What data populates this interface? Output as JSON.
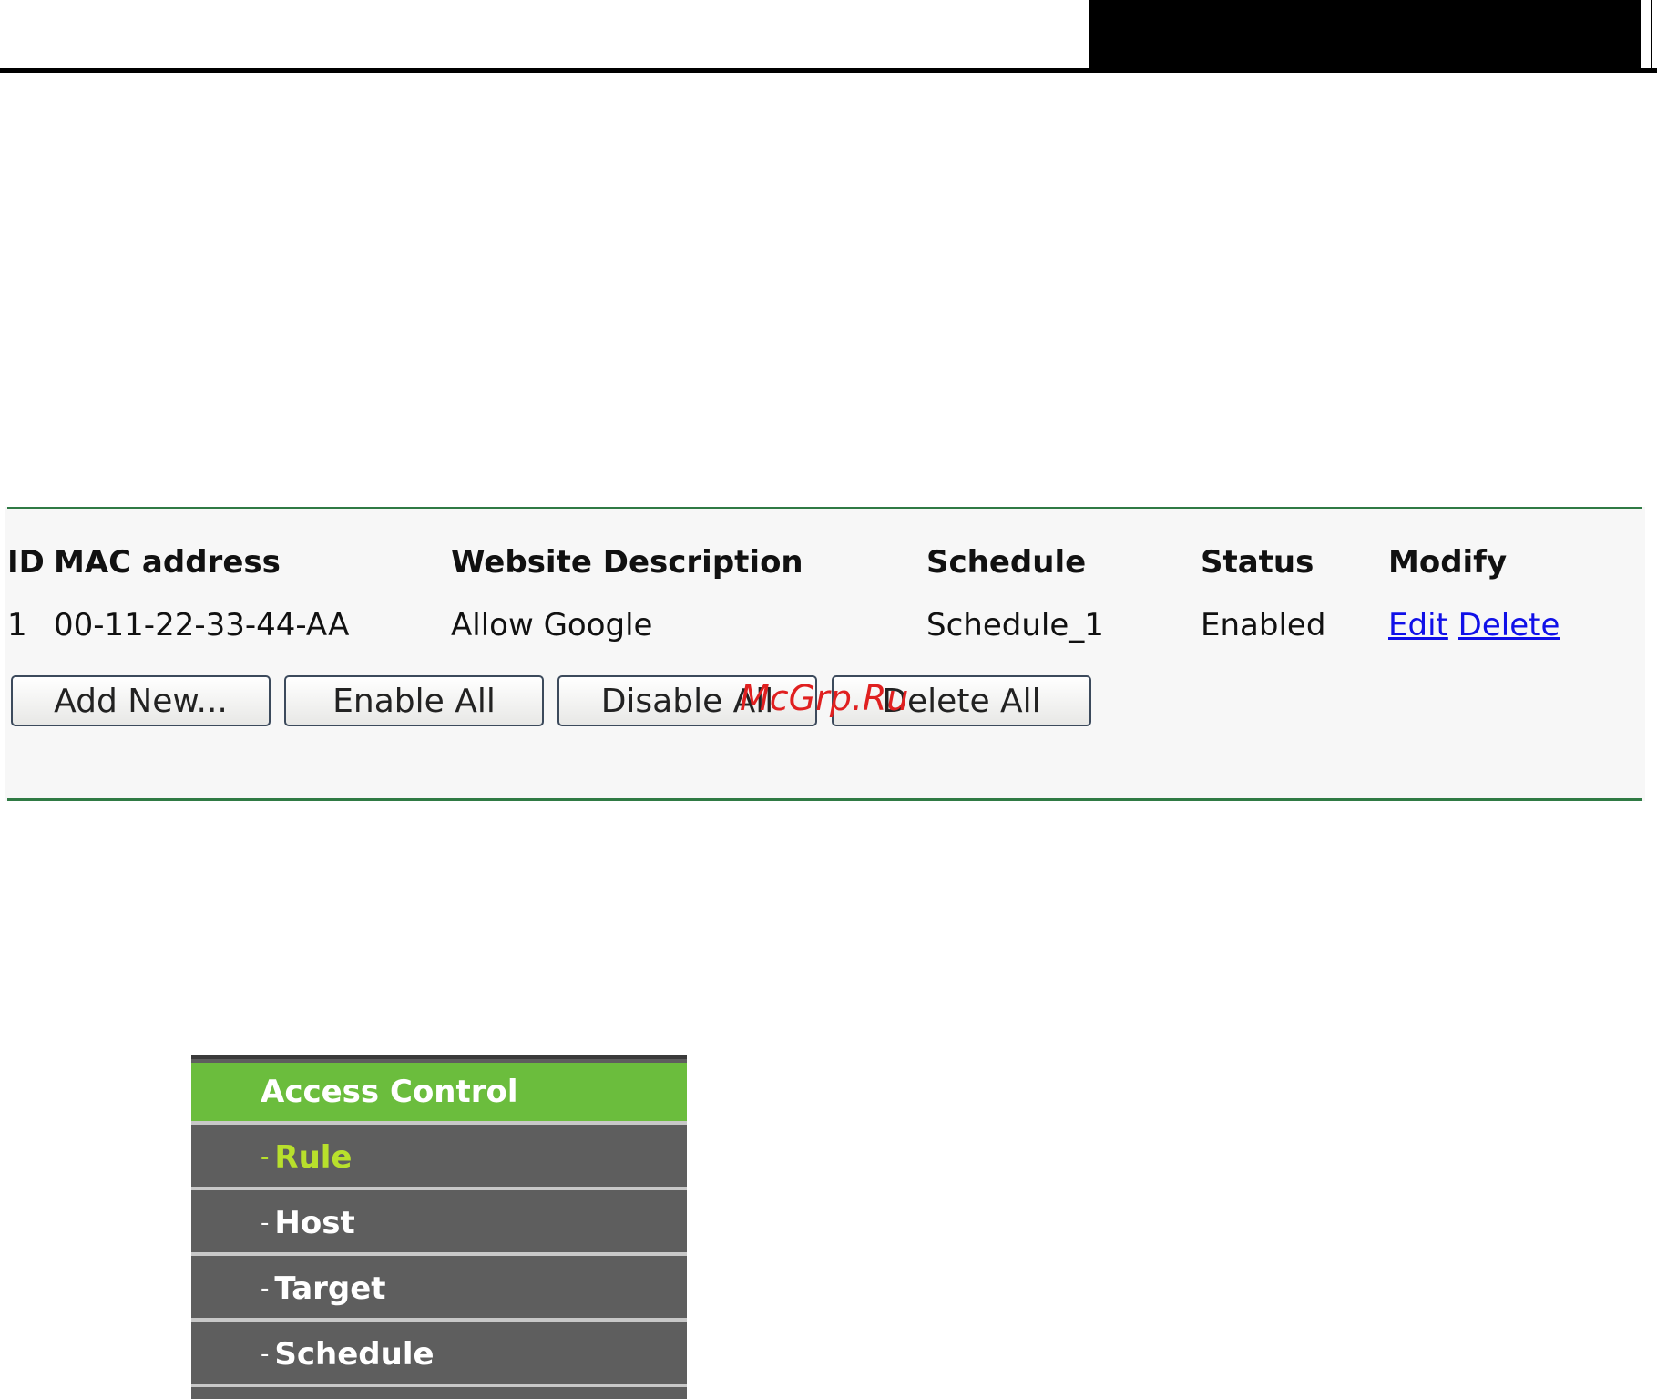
{
  "table": {
    "headers": [
      "ID",
      "MAC address",
      "Website Description",
      "Schedule",
      "Status",
      "Modify"
    ],
    "rows": [
      {
        "id": "1",
        "mac": "00-11-22-33-44-AA",
        "description": "Allow Google",
        "schedule": "Schedule_1",
        "status": "Enabled",
        "edit": "Edit",
        "delete": "Delete"
      }
    ]
  },
  "buttons": {
    "add_new": "Add New...",
    "enable_all": "Enable All",
    "disable_all": "Disable All",
    "delete_all": "Delete All"
  },
  "watermark": "McGrp.Ru",
  "menu": {
    "title": "Access Control",
    "items": [
      {
        "dash": "-",
        "label": "Rule",
        "active": true
      },
      {
        "dash": "-",
        "label": "Host",
        "active": false
      },
      {
        "dash": "-",
        "label": "Target",
        "active": false
      },
      {
        "dash": "-",
        "label": "Schedule",
        "active": false
      }
    ]
  },
  "colors": {
    "accent_green": "#6bbd3d",
    "active_item": "#b8e02c",
    "link": "#1010e8",
    "rule_line": "#2f7a44",
    "menu_bg": "#5e5e5e"
  }
}
